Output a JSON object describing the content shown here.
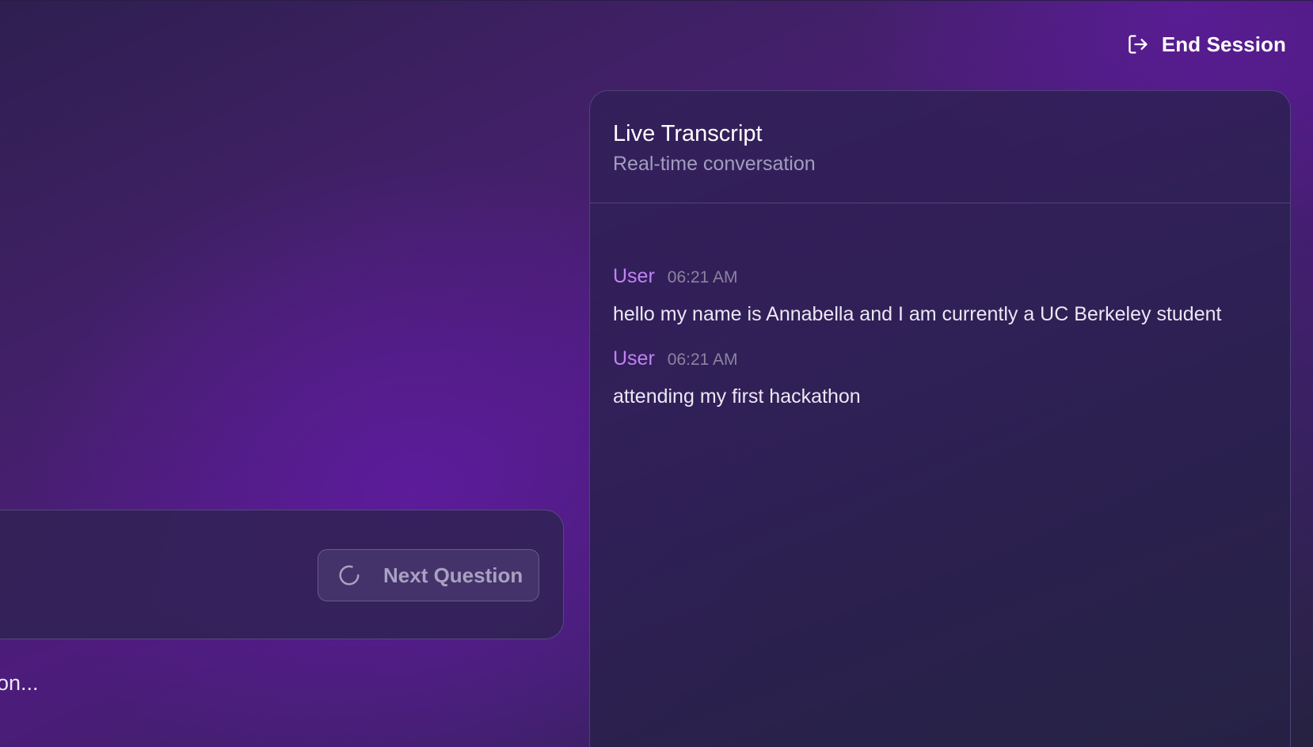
{
  "header": {
    "end_session_label": "End Session",
    "end_session_icon": "logout-icon"
  },
  "transcript": {
    "title": "Live Transcript",
    "subtitle": "Real-time conversation",
    "messages": [
      {
        "speaker": "User",
        "time": "06:21 AM",
        "text": "hello my name is Annabella and I am currently a UC Berkeley student"
      },
      {
        "speaker": "User",
        "time": "06:21 AM",
        "text": "attending my first hackathon"
      }
    ]
  },
  "controls": {
    "next_question_label": "Next Question",
    "next_question_icon": "loading-spinner-icon",
    "next_question_disabled": true
  },
  "status": {
    "text": "on..."
  },
  "colors": {
    "accent_speaker": "#c083f5",
    "background_purple": "#4d1c7c",
    "panel_bg": "#2c2052"
  }
}
